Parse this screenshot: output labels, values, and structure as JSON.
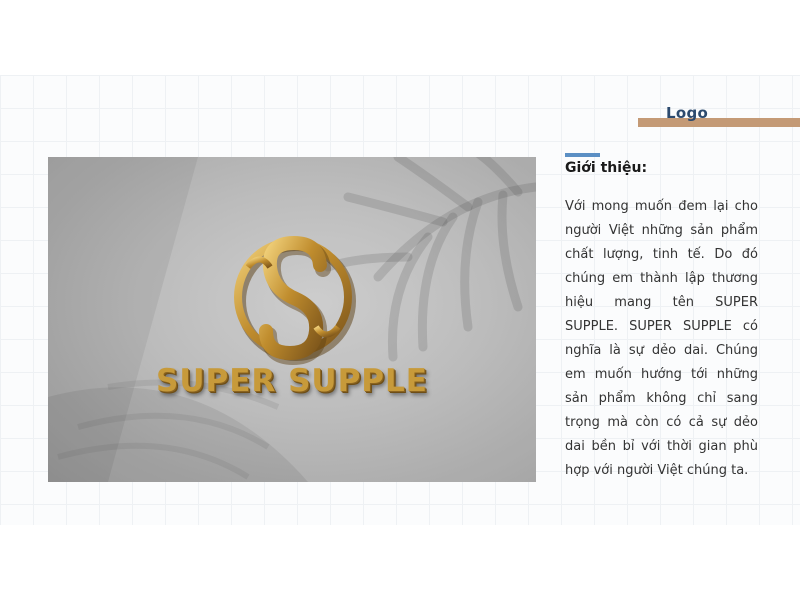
{
  "section_label": "Logo",
  "intro": {
    "heading": "Giới thiệu:",
    "body": "Với mong muốn đem lại cho người Việt những sản phẩm chất lượng, tinh tế. Do đó chúng em thành lập thương hiệu mang tên SUPER SUPPLE. SUPER SUPPLE có nghĩa là sự dẻo dai. Chúng em muốn hướng tới những sản phẩm không chỉ sang trọng mà còn có cả sự dẻo dai bền bỉ với thời gian phù hợp với người Việt chúng ta."
  },
  "mockup": {
    "brand_name": "SUPER SUPPLE",
    "emblem_letter": "S"
  },
  "colors": {
    "accent_tan": "#c49a76",
    "accent_blue": "#5b8fc4",
    "heading_navy": "#2c4a6e",
    "logo_gold": "#c79a3a"
  }
}
